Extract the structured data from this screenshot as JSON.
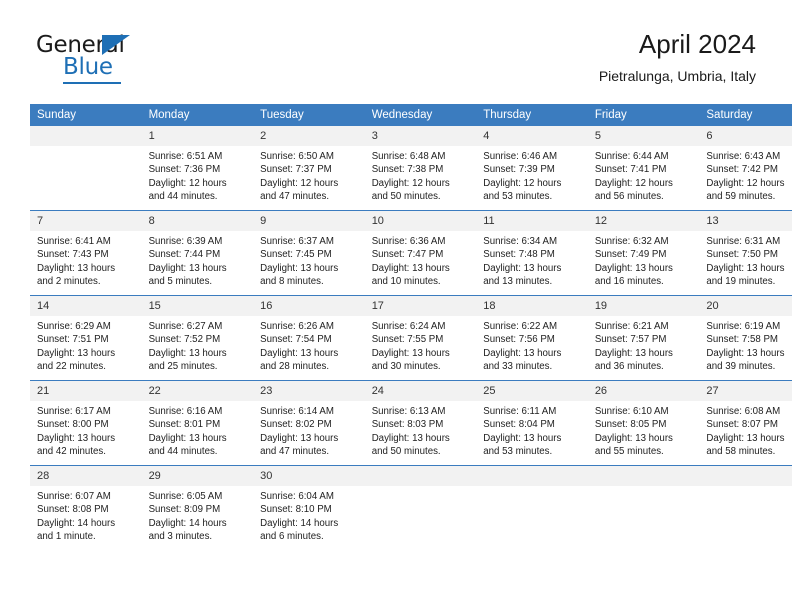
{
  "brand": {
    "name_top": "General",
    "name_bottom": "Blue",
    "triangle_icon": "triangle-icon",
    "accent_color": "#1e6fb5"
  },
  "header": {
    "title": "April 2024",
    "subtitle": "Pietralunga, Umbria, Italy"
  },
  "colors": {
    "header_blue": "#3b7cbf",
    "daynum_band": "#f2f2f2",
    "text": "#222222"
  },
  "weekday_headers": [
    "Sunday",
    "Monday",
    "Tuesday",
    "Wednesday",
    "Thursday",
    "Friday",
    "Saturday"
  ],
  "weeks": [
    [
      {
        "day": "",
        "blank": true,
        "sunrise": "",
        "sunset": "",
        "daylight_1": "",
        "daylight_2": ""
      },
      {
        "day": "1",
        "sunrise": "Sunrise: 6:51 AM",
        "sunset": "Sunset: 7:36 PM",
        "daylight_1": "Daylight: 12 hours",
        "daylight_2": "and 44 minutes."
      },
      {
        "day": "2",
        "sunrise": "Sunrise: 6:50 AM",
        "sunset": "Sunset: 7:37 PM",
        "daylight_1": "Daylight: 12 hours",
        "daylight_2": "and 47 minutes."
      },
      {
        "day": "3",
        "sunrise": "Sunrise: 6:48 AM",
        "sunset": "Sunset: 7:38 PM",
        "daylight_1": "Daylight: 12 hours",
        "daylight_2": "and 50 minutes."
      },
      {
        "day": "4",
        "sunrise": "Sunrise: 6:46 AM",
        "sunset": "Sunset: 7:39 PM",
        "daylight_1": "Daylight: 12 hours",
        "daylight_2": "and 53 minutes."
      },
      {
        "day": "5",
        "sunrise": "Sunrise: 6:44 AM",
        "sunset": "Sunset: 7:41 PM",
        "daylight_1": "Daylight: 12 hours",
        "daylight_2": "and 56 minutes."
      },
      {
        "day": "6",
        "sunrise": "Sunrise: 6:43 AM",
        "sunset": "Sunset: 7:42 PM",
        "daylight_1": "Daylight: 12 hours",
        "daylight_2": "and 59 minutes."
      }
    ],
    [
      {
        "day": "7",
        "sunrise": "Sunrise: 6:41 AM",
        "sunset": "Sunset: 7:43 PM",
        "daylight_1": "Daylight: 13 hours",
        "daylight_2": "and 2 minutes."
      },
      {
        "day": "8",
        "sunrise": "Sunrise: 6:39 AM",
        "sunset": "Sunset: 7:44 PM",
        "daylight_1": "Daylight: 13 hours",
        "daylight_2": "and 5 minutes."
      },
      {
        "day": "9",
        "sunrise": "Sunrise: 6:37 AM",
        "sunset": "Sunset: 7:45 PM",
        "daylight_1": "Daylight: 13 hours",
        "daylight_2": "and 8 minutes."
      },
      {
        "day": "10",
        "sunrise": "Sunrise: 6:36 AM",
        "sunset": "Sunset: 7:47 PM",
        "daylight_1": "Daylight: 13 hours",
        "daylight_2": "and 10 minutes."
      },
      {
        "day": "11",
        "sunrise": "Sunrise: 6:34 AM",
        "sunset": "Sunset: 7:48 PM",
        "daylight_1": "Daylight: 13 hours",
        "daylight_2": "and 13 minutes."
      },
      {
        "day": "12",
        "sunrise": "Sunrise: 6:32 AM",
        "sunset": "Sunset: 7:49 PM",
        "daylight_1": "Daylight: 13 hours",
        "daylight_2": "and 16 minutes."
      },
      {
        "day": "13",
        "sunrise": "Sunrise: 6:31 AM",
        "sunset": "Sunset: 7:50 PM",
        "daylight_1": "Daylight: 13 hours",
        "daylight_2": "and 19 minutes."
      }
    ],
    [
      {
        "day": "14",
        "sunrise": "Sunrise: 6:29 AM",
        "sunset": "Sunset: 7:51 PM",
        "daylight_1": "Daylight: 13 hours",
        "daylight_2": "and 22 minutes."
      },
      {
        "day": "15",
        "sunrise": "Sunrise: 6:27 AM",
        "sunset": "Sunset: 7:52 PM",
        "daylight_1": "Daylight: 13 hours",
        "daylight_2": "and 25 minutes."
      },
      {
        "day": "16",
        "sunrise": "Sunrise: 6:26 AM",
        "sunset": "Sunset: 7:54 PM",
        "daylight_1": "Daylight: 13 hours",
        "daylight_2": "and 28 minutes."
      },
      {
        "day": "17",
        "sunrise": "Sunrise: 6:24 AM",
        "sunset": "Sunset: 7:55 PM",
        "daylight_1": "Daylight: 13 hours",
        "daylight_2": "and 30 minutes."
      },
      {
        "day": "18",
        "sunrise": "Sunrise: 6:22 AM",
        "sunset": "Sunset: 7:56 PM",
        "daylight_1": "Daylight: 13 hours",
        "daylight_2": "and 33 minutes."
      },
      {
        "day": "19",
        "sunrise": "Sunrise: 6:21 AM",
        "sunset": "Sunset: 7:57 PM",
        "daylight_1": "Daylight: 13 hours",
        "daylight_2": "and 36 minutes."
      },
      {
        "day": "20",
        "sunrise": "Sunrise: 6:19 AM",
        "sunset": "Sunset: 7:58 PM",
        "daylight_1": "Daylight: 13 hours",
        "daylight_2": "and 39 minutes."
      }
    ],
    [
      {
        "day": "21",
        "sunrise": "Sunrise: 6:17 AM",
        "sunset": "Sunset: 8:00 PM",
        "daylight_1": "Daylight: 13 hours",
        "daylight_2": "and 42 minutes."
      },
      {
        "day": "22",
        "sunrise": "Sunrise: 6:16 AM",
        "sunset": "Sunset: 8:01 PM",
        "daylight_1": "Daylight: 13 hours",
        "daylight_2": "and 44 minutes."
      },
      {
        "day": "23",
        "sunrise": "Sunrise: 6:14 AM",
        "sunset": "Sunset: 8:02 PM",
        "daylight_1": "Daylight: 13 hours",
        "daylight_2": "and 47 minutes."
      },
      {
        "day": "24",
        "sunrise": "Sunrise: 6:13 AM",
        "sunset": "Sunset: 8:03 PM",
        "daylight_1": "Daylight: 13 hours",
        "daylight_2": "and 50 minutes."
      },
      {
        "day": "25",
        "sunrise": "Sunrise: 6:11 AM",
        "sunset": "Sunset: 8:04 PM",
        "daylight_1": "Daylight: 13 hours",
        "daylight_2": "and 53 minutes."
      },
      {
        "day": "26",
        "sunrise": "Sunrise: 6:10 AM",
        "sunset": "Sunset: 8:05 PM",
        "daylight_1": "Daylight: 13 hours",
        "daylight_2": "and 55 minutes."
      },
      {
        "day": "27",
        "sunrise": "Sunrise: 6:08 AM",
        "sunset": "Sunset: 8:07 PM",
        "daylight_1": "Daylight: 13 hours",
        "daylight_2": "and 58 minutes."
      }
    ],
    [
      {
        "day": "28",
        "sunrise": "Sunrise: 6:07 AM",
        "sunset": "Sunset: 8:08 PM",
        "daylight_1": "Daylight: 14 hours",
        "daylight_2": "and 1 minute."
      },
      {
        "day": "29",
        "sunrise": "Sunrise: 6:05 AM",
        "sunset": "Sunset: 8:09 PM",
        "daylight_1": "Daylight: 14 hours",
        "daylight_2": "and 3 minutes."
      },
      {
        "day": "30",
        "sunrise": "Sunrise: 6:04 AM",
        "sunset": "Sunset: 8:10 PM",
        "daylight_1": "Daylight: 14 hours",
        "daylight_2": "and 6 minutes."
      },
      {
        "day": "",
        "blank": true,
        "sunrise": "",
        "sunset": "",
        "daylight_1": "",
        "daylight_2": ""
      },
      {
        "day": "",
        "blank": true,
        "sunrise": "",
        "sunset": "",
        "daylight_1": "",
        "daylight_2": ""
      },
      {
        "day": "",
        "blank": true,
        "sunrise": "",
        "sunset": "",
        "daylight_1": "",
        "daylight_2": ""
      },
      {
        "day": "",
        "blank": true,
        "sunrise": "",
        "sunset": "",
        "daylight_1": "",
        "daylight_2": ""
      }
    ]
  ]
}
